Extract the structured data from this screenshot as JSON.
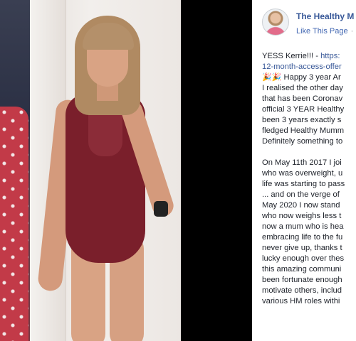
{
  "page": {
    "name": "The Healthy M",
    "like_link": "Like This Page",
    "like_separator": "·"
  },
  "post": {
    "para1": {
      "line1_prefix": "YESS Kerrie!!! - ",
      "line1_link": "https:",
      "line2_link": "12-month-access-offer",
      "line3_emoji": "🎉🎉",
      "line3_text": " Happy 3 year Ar",
      "lines": [
        "I realised the other day",
        "that has been Coronav",
        "official 3 YEAR Healthy",
        "been 3 years exactly s",
        "fledged Healthy Mumm",
        "Definitely something to"
      ]
    },
    "para2": {
      "lines": [
        "On May 11th 2017 I joi",
        "who was overweight, u",
        "life was starting to pass",
        "... and on the verge of",
        "May 2020 I now stand",
        "who now weighs less t",
        "now a mum who is hea",
        "embracing life to the fu",
        "never give up, thanks t",
        "lucky enough over thes",
        "this amazing communi",
        "been fortunate enough",
        "motivate others, includ",
        "various HM roles withi"
      ]
    }
  }
}
